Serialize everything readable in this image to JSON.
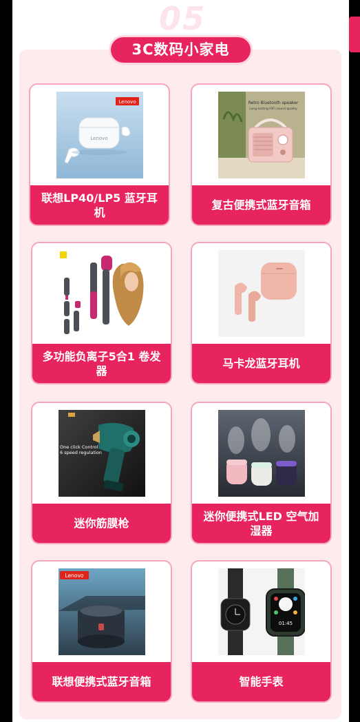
{
  "section": {
    "number": "05",
    "title": "3C数码小家电"
  },
  "products": [
    {
      "name": "联想LP40/LP5 蓝牙耳机",
      "image_text": [
        "Lenovo",
        "Lenovo"
      ]
    },
    {
      "name": "复古便携式蓝牙音箱",
      "image_text": [
        "Retro Bluetooth speaker",
        "Long-lasting HIFI sound quality"
      ]
    },
    {
      "name": "多功能负离子5合1 卷发器",
      "image_text": []
    },
    {
      "name": "马卡龙蓝牙耳机",
      "image_text": []
    },
    {
      "name": "迷你筋膜枪",
      "image_text": [
        "One click Control",
        "6 speed regulation"
      ]
    },
    {
      "name": "迷你便携式LED 空气加湿器",
      "image_text": []
    },
    {
      "name": "联想便携式蓝牙音箱",
      "image_text": [
        "Lenovo"
      ]
    },
    {
      "name": "智能手表",
      "image_text": [
        "01:45"
      ]
    }
  ],
  "colors": {
    "brand": "#e8245e",
    "panel_bg": "#fdebee",
    "card_border": "#f7a5bb",
    "number_ghost": "#fde4ea"
  }
}
